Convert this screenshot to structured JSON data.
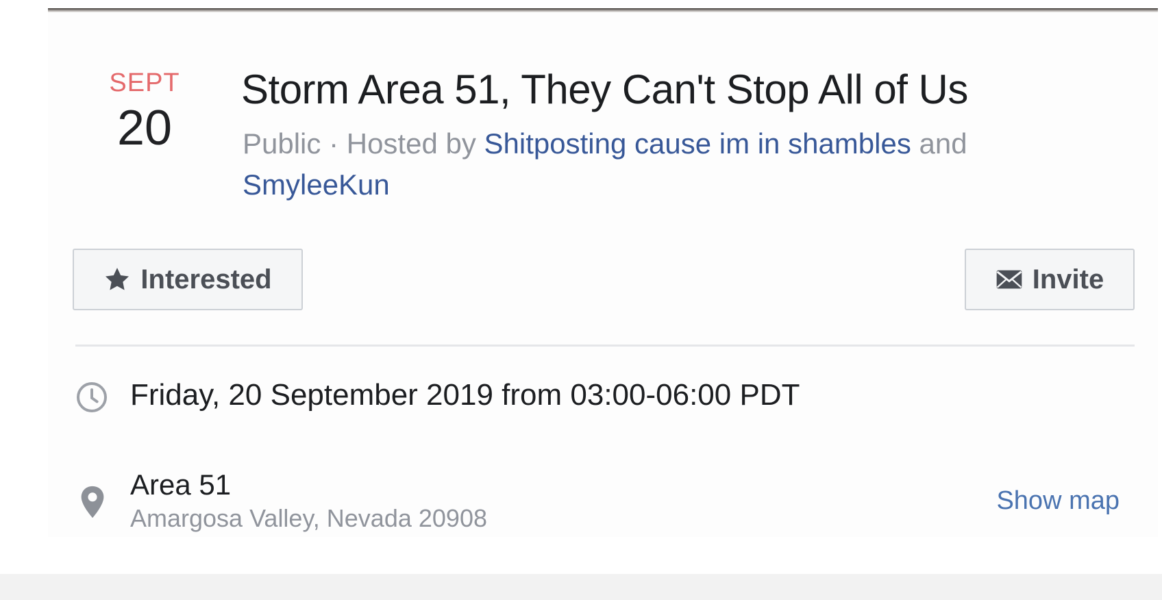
{
  "event": {
    "month": "SEPT",
    "day": "20",
    "title": "Storm Area 51, They Can't Stop All of Us",
    "privacy": "Public",
    "meta_separator": " · ",
    "hosted_by_prefix": "Hosted by ",
    "hosts": [
      "Shitposting cause im in shambles",
      "SmyleeKun"
    ],
    "hosts_joiner": " and "
  },
  "actions": {
    "interested_label": "Interested",
    "invite_label": "Invite"
  },
  "details": {
    "time": "Friday, 20 September 2019 from 03:00-06:00 PDT",
    "location_name": "Area 51",
    "location_address": "Amargosa Valley, Nevada 20908",
    "show_map_label": "Show map"
  },
  "icons": {
    "interested": "star-icon",
    "invite": "envelope-icon",
    "time": "clock-icon",
    "location": "map-pin-icon"
  },
  "colors": {
    "month": "#e4696b",
    "link": "#385898",
    "muted": "#90949c",
    "text": "#1c1e21"
  }
}
